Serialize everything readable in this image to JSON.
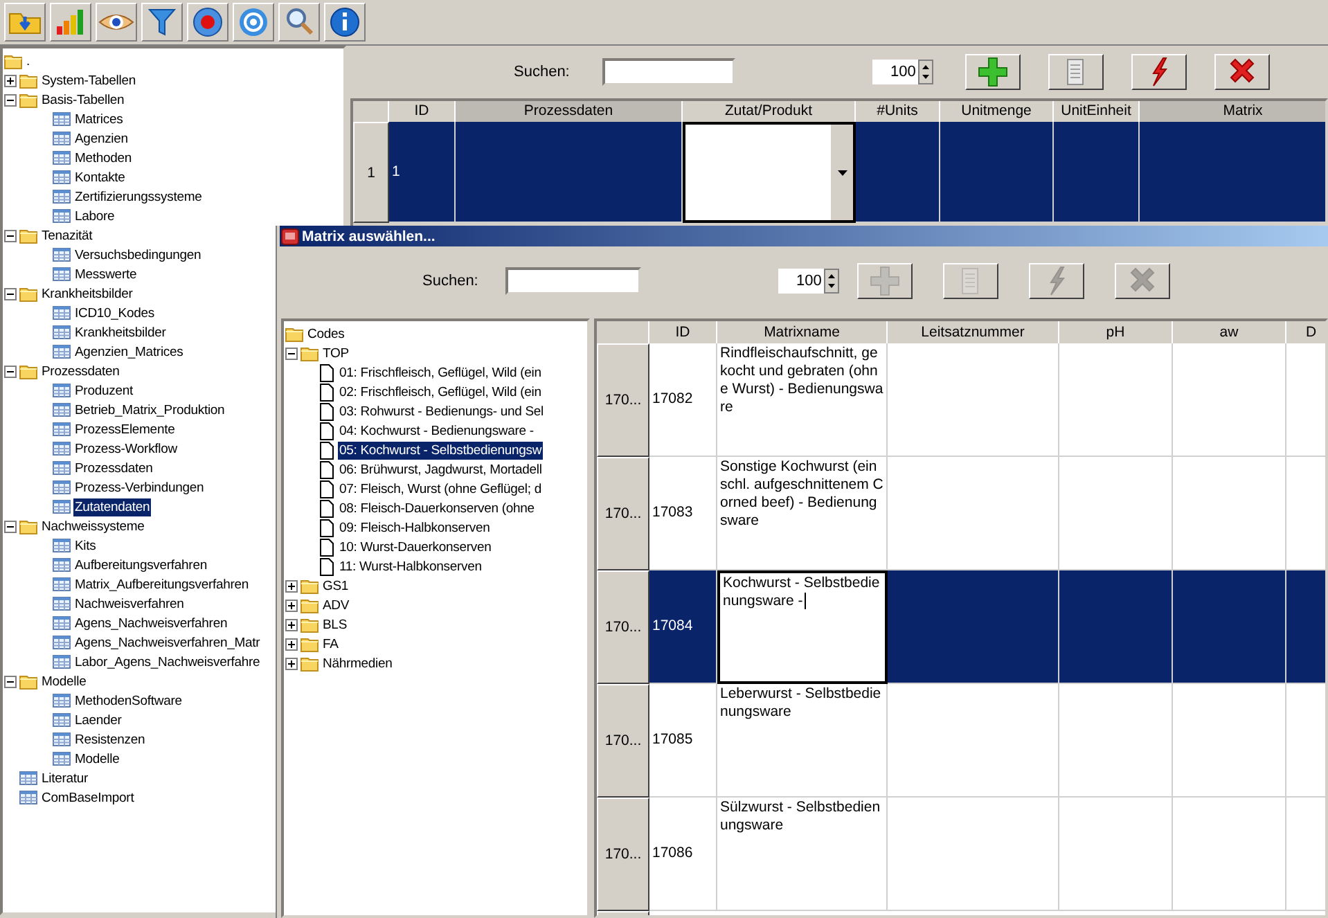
{
  "toolbar": [
    {
      "kind": "folder"
    },
    {
      "kind": "chart"
    },
    {
      "kind": "eye"
    },
    {
      "kind": "filter"
    },
    {
      "kind": "record"
    },
    {
      "kind": "target"
    },
    {
      "kind": "search"
    },
    {
      "kind": "info"
    }
  ],
  "navigation_tree": {
    "label": ".",
    "kind": "folder",
    "selected": false,
    "children": [
      {
        "label": "System-Tabellen",
        "kind": "folder",
        "expanded": false,
        "selected": false
      },
      {
        "label": "Basis-Tabellen",
        "kind": "folder",
        "expanded": true,
        "selected": false,
        "children": [
          {
            "label": "Matrices",
            "kind": "table",
            "selected": false
          },
          {
            "label": "Agenzien",
            "kind": "table",
            "selected": false
          },
          {
            "label": "Methoden",
            "kind": "table",
            "selected": false
          },
          {
            "label": "Kontakte",
            "kind": "table",
            "selected": false
          },
          {
            "label": "Zertifizierungssysteme",
            "kind": "table",
            "selected": false
          },
          {
            "label": "Labore",
            "kind": "table",
            "selected": false
          }
        ]
      },
      {
        "label": "Tenazität",
        "kind": "folder",
        "expanded": true,
        "selected": false,
        "children": [
          {
            "label": "Versuchsbedingungen",
            "kind": "table",
            "selected": false
          },
          {
            "label": "Messwerte",
            "kind": "table",
            "selected": false
          }
        ]
      },
      {
        "label": "Krankheitsbilder",
        "kind": "folder",
        "expanded": true,
        "selected": false,
        "children": [
          {
            "label": "ICD10_Kodes",
            "kind": "table",
            "selected": false
          },
          {
            "label": "Krankheitsbilder",
            "kind": "table",
            "selected": false
          },
          {
            "label": "Agenzien_Matrices",
            "kind": "table",
            "selected": false
          }
        ]
      },
      {
        "label": "Prozessdaten",
        "kind": "folder",
        "expanded": true,
        "selected": false,
        "children": [
          {
            "label": "Produzent",
            "kind": "table",
            "selected": false
          },
          {
            "label": "Betrieb_Matrix_Produktion",
            "kind": "table",
            "selected": false
          },
          {
            "label": "ProzessElemente",
            "kind": "table",
            "selected": false
          },
          {
            "label": "Prozess-Workflow",
            "kind": "table",
            "selected": false
          },
          {
            "label": "Prozessdaten",
            "kind": "table",
            "selected": false
          },
          {
            "label": "Prozess-Verbindungen",
            "kind": "table",
            "selected": false
          },
          {
            "label": "Zutatendaten",
            "kind": "table",
            "selected": true
          }
        ]
      },
      {
        "label": "Nachweissysteme",
        "kind": "folder",
        "expanded": true,
        "selected": false,
        "children": [
          {
            "label": "Kits",
            "kind": "table",
            "selected": false
          },
          {
            "label": "Aufbereitungsverfahren",
            "kind": "table",
            "selected": false
          },
          {
            "label": "Matrix_Aufbereitungsverfahren",
            "kind": "table",
            "selected": false
          },
          {
            "label": "Nachweisverfahren",
            "kind": "table",
            "selected": false
          },
          {
            "label": "Agens_Nachweisverfahren",
            "kind": "table",
            "selected": false
          },
          {
            "label": "Agens_Nachweisverfahren_Matr",
            "kind": "table",
            "selected": false
          },
          {
            "label": "Labor_Agens_Nachweisverfahre",
            "kind": "table",
            "selected": false
          }
        ]
      },
      {
        "label": "Modelle",
        "kind": "folder",
        "expanded": true,
        "selected": false,
        "children": [
          {
            "label": "MethodenSoftware",
            "kind": "table",
            "selected": false
          },
          {
            "label": "Laender",
            "kind": "table",
            "selected": false
          },
          {
            "label": "Resistenzen",
            "kind": "table",
            "selected": false
          },
          {
            "label": "Modelle",
            "kind": "table",
            "selected": false
          }
        ]
      },
      {
        "label": "Literatur",
        "kind": "table",
        "selected": false
      },
      {
        "label": "ComBaseImport",
        "kind": "table",
        "selected": false
      }
    ]
  },
  "main_panel": {
    "search": {
      "label": "Suchen:"
    },
    "page_size": "100",
    "buttons": [
      {
        "kind": "add",
        "disabled": false
      },
      {
        "kind": "document",
        "disabled": false
      },
      {
        "kind": "lightning",
        "disabled": false
      },
      {
        "kind": "delete",
        "disabled": false
      }
    ],
    "table": {
      "columns": [
        {
          "label": "ID",
          "highlighted": false
        },
        {
          "label": "Prozessdaten",
          "highlighted": true
        },
        {
          "label": "Zutat/Produkt",
          "highlighted": false
        },
        {
          "label": "#Units",
          "highlighted": false
        },
        {
          "label": "Unitmenge",
          "highlighted": false
        },
        {
          "label": "UnitEinheit",
          "highlighted": false
        },
        {
          "label": "Matrix",
          "highlighted": true
        }
      ],
      "rows": [
        {
          "row_header": "1",
          "selected": true,
          "cells": [
            {
              "text": "1"
            },
            {},
            {
              "kind": "dropdown"
            },
            {},
            {},
            {},
            {}
          ]
        }
      ]
    }
  },
  "dialog": {
    "title": "Matrix auswählen...",
    "search": {
      "label": "Suchen:"
    },
    "page_size": "100",
    "buttons": [
      {
        "kind": "add",
        "disabled": true
      },
      {
        "kind": "document",
        "disabled": true
      },
      {
        "kind": "lightning",
        "disabled": true
      },
      {
        "kind": "delete",
        "disabled": true
      }
    ],
    "tree": {
      "label": "Codes",
      "kind": "folder",
      "selected": false,
      "children": [
        {
          "label": "TOP",
          "kind": "folder",
          "expanded": true,
          "selected": false,
          "children": [
            {
              "label": "01: Frischfleisch, Geflügel, Wild (ein",
              "kind": "document",
              "selected": false
            },
            {
              "label": "02: Frischfleisch, Geflügel, Wild (ein",
              "kind": "document",
              "selected": false
            },
            {
              "label": "03: Rohwurst - Bedienungs- und Sel",
              "kind": "document",
              "selected": false
            },
            {
              "label": "04: Kochwurst - Bedienungsware -",
              "kind": "document",
              "selected": false
            },
            {
              "label": "05: Kochwurst - Selbstbedienungsw",
              "kind": "document",
              "selected": true
            },
            {
              "label": "06: Brühwurst, Jagdwurst, Mortadell",
              "kind": "document",
              "selected": false
            },
            {
              "label": "07: Fleisch, Wurst (ohne Geflügel; d",
              "kind": "document",
              "selected": false
            },
            {
              "label": "08: Fleisch-Dauerkonserven (ohne",
              "kind": "document",
              "selected": false
            },
            {
              "label": "09: Fleisch-Halbkonserven",
              "kind": "document",
              "selected": false
            },
            {
              "label": "10: Wurst-Dauerkonserven",
              "kind": "document",
              "selected": false
            },
            {
              "label": "11: Wurst-Halbkonserven",
              "kind": "document",
              "selected": false
            }
          ]
        },
        {
          "label": "GS1",
          "kind": "folder",
          "expanded": false,
          "selected": false
        },
        {
          "label": "ADV",
          "kind": "folder",
          "expanded": false,
          "selected": false
        },
        {
          "label": "BLS",
          "kind": "folder",
          "expanded": false,
          "selected": false
        },
        {
          "label": "FA",
          "kind": "folder",
          "expanded": false,
          "selected": false
        },
        {
          "label": "Nährmedien",
          "kind": "folder",
          "expanded": false,
          "selected": false
        }
      ]
    },
    "table": {
      "columns": [
        {
          "label": "ID",
          "highlighted": false
        },
        {
          "label": "Matrixname",
          "highlighted": false
        },
        {
          "label": "Leitsatznummer",
          "highlighted": false
        },
        {
          "label": "pH",
          "highlighted": false
        },
        {
          "label": "aw",
          "highlighted": false
        },
        {
          "label": "D",
          "highlighted": false
        }
      ],
      "rows": [
        {
          "row_header": "170...",
          "selected": false,
          "cells": [
            {
              "text": "17082"
            },
            {
              "text": "Rindfleischaufschnitt, gekocht und gebraten (ohne Wurst) - Bedienungsware"
            },
            {},
            {},
            {},
            {}
          ]
        },
        {
          "row_header": "170...",
          "selected": false,
          "cells": [
            {
              "text": "17083"
            },
            {
              "text": "Sonstige Kochwurst (einschl. aufgeschnittenem Corned beef) - Bedienungsware"
            },
            {},
            {},
            {},
            {}
          ]
        },
        {
          "row_header": "170...",
          "selected": true,
          "cells": [
            {
              "text": "17084"
            },
            {
              "text": "Kochwurst - Selbstbedienungsware -",
              "kind": "text"
            },
            {},
            {},
            {},
            {}
          ]
        },
        {
          "row_header": "170...",
          "selected": false,
          "cells": [
            {
              "text": "17085"
            },
            {
              "text": "Leberwurst - Selbstbedienungsware"
            },
            {},
            {},
            {},
            {}
          ]
        },
        {
          "row_header": "170...",
          "selected": false,
          "cells": [
            {
              "text": "17086"
            },
            {
              "text": "Sülzwurst - Selbstbedienungsware"
            },
            {},
            {},
            {},
            {}
          ]
        }
      ]
    }
  }
}
